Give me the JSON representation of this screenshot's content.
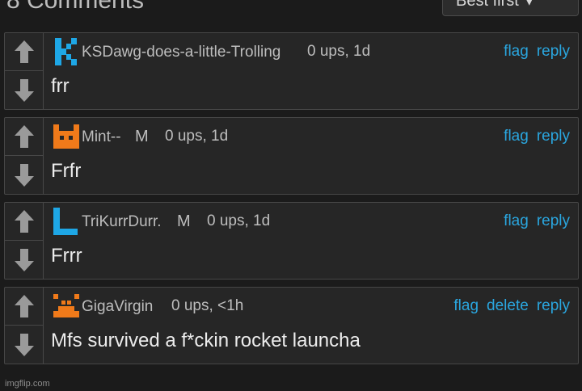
{
  "header": {
    "title": "8 Comments",
    "sort_label": "Best first",
    "sort_chevron": "▾"
  },
  "comments": [
    {
      "username": "KSDawg-does-a-little-Trolling",
      "mod_badge": "",
      "meta": "0 ups, 1d",
      "actions": [
        "flag",
        "reply"
      ],
      "text": "frr",
      "avatar_icon": "k-letter-avatar-icon",
      "avatar_color": "#1ea7e6"
    },
    {
      "username": "Mint--",
      "mod_badge": "M",
      "meta": "0 ups, 1d",
      "actions": [
        "flag",
        "reply"
      ],
      "text": "Frfr",
      "avatar_icon": "cat-face-avatar-icon",
      "avatar_color": "#f07a1a"
    },
    {
      "username": "TriKurrDurr.",
      "mod_badge": "M",
      "meta": "0 ups, 1d",
      "actions": [
        "flag",
        "reply"
      ],
      "text": "Frrr",
      "avatar_icon": "l-letter-avatar-icon",
      "avatar_color": "#1ea7e6"
    },
    {
      "username": "GigaVirgin",
      "mod_badge": "",
      "meta": "0 ups, <1h",
      "actions": [
        "flag",
        "delete",
        "reply"
      ],
      "text": "Mfs survived a f*ckin rocket launcha",
      "avatar_icon": "invader-avatar-icon",
      "avatar_color": "#f07a1a"
    }
  ],
  "watermark": "imgflip.com",
  "colors": {
    "background": "#1b1b1b",
    "card": "#262626",
    "border": "#474747",
    "link": "#2aa6df",
    "arrow": "#9a9a9a"
  }
}
